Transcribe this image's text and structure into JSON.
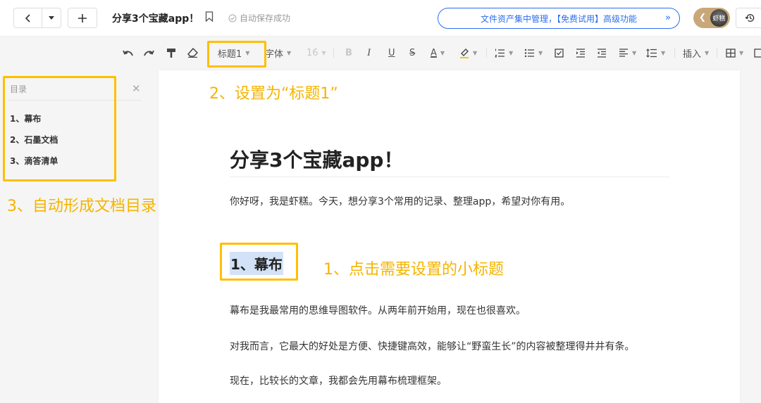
{
  "topbar": {
    "doc_title": "分享3个宝藏app！",
    "save_status": "自动保存成功",
    "promo_text": "文件资产集中管理，【免费试用】高级功能",
    "promo_arrows": "»",
    "avatar_text": "虾糕"
  },
  "toolbar": {
    "style_select": "标题1",
    "font_select": "字体",
    "font_size": "16",
    "bold": "B",
    "italic": "I",
    "underline": "U",
    "strike": "S",
    "font_color": "A",
    "insert_label": "插入"
  },
  "toc": {
    "title": "目录",
    "items": [
      {
        "label": "1、幕布"
      },
      {
        "label": "2、石墨文档"
      },
      {
        "label": "3、滴答清单"
      }
    ]
  },
  "doc": {
    "h1": "分享3个宝藏app！",
    "intro": "你好呀，我是虾糕。今天，想分享3个常用的记录、整理app，希望对你有用。",
    "h2": "1、幕布",
    "paragraphs": [
      "幕布是我最常用的思维导图软件。从两年前开始用，现在也很喜欢。",
      "对我而言，它最大的好处是方便、快捷键高效，能够让“野蛮生长”的内容被整理得井井有条。",
      "现在，比较长的文章，我都会先用幕布梳理框架。"
    ]
  },
  "annotations": {
    "step1": "1、点击需要设置的小标题",
    "step2": "2、设置为“标题1”",
    "step3": "3、自动形成文档目录"
  },
  "colors": {
    "accent": "#2b6ef0",
    "annotation": "#f5b400",
    "highlight": "#d3e2f7"
  }
}
